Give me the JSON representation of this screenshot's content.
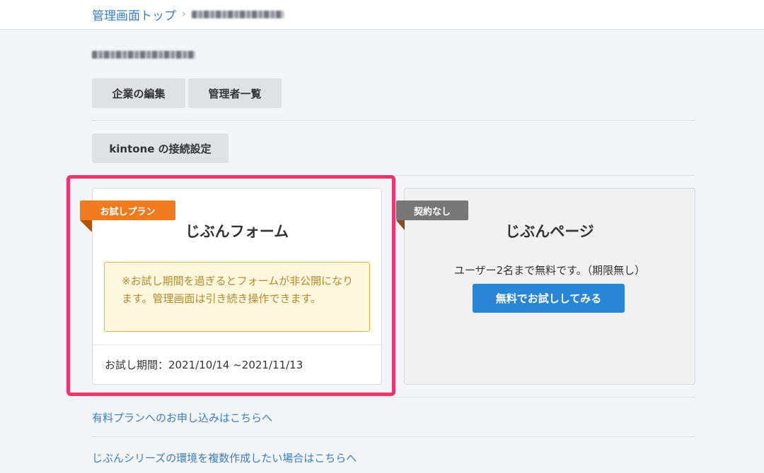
{
  "breadcrumb": {
    "home": "管理画面トップ",
    "separator": "›"
  },
  "actions": {
    "edit_company": "企業の編集",
    "admin_list": "管理者一覧",
    "kintone_settings": "kintone の接続設定"
  },
  "plans": [
    {
      "ribbon": "お試しプラン",
      "ribbon_color": "#f07b1e",
      "title": "じぶんフォーム",
      "notice": "※お試し期間を過ぎるとフォームが非公開になります。管理画面は引き続き操作できます。",
      "period": "お試し期間：2021/10/14 ~2021/11/13"
    },
    {
      "ribbon": "契約なし",
      "ribbon_color": "#777777",
      "title": "じぶんページ",
      "description": "ユーザー2名まで無料です。（期限無し）",
      "cta": "無料でお試ししてみる"
    }
  ],
  "links": {
    "paid_plan": "有料プランへのお申し込みはこちらへ",
    "multi_env": "じぶんシリーズの環境を複数作成したい場合はこちらへ"
  },
  "colors": {
    "link": "#3a7ec0",
    "primary_button": "#2985d6",
    "highlight": "#f0346c",
    "notice_border": "#d9b54a"
  }
}
